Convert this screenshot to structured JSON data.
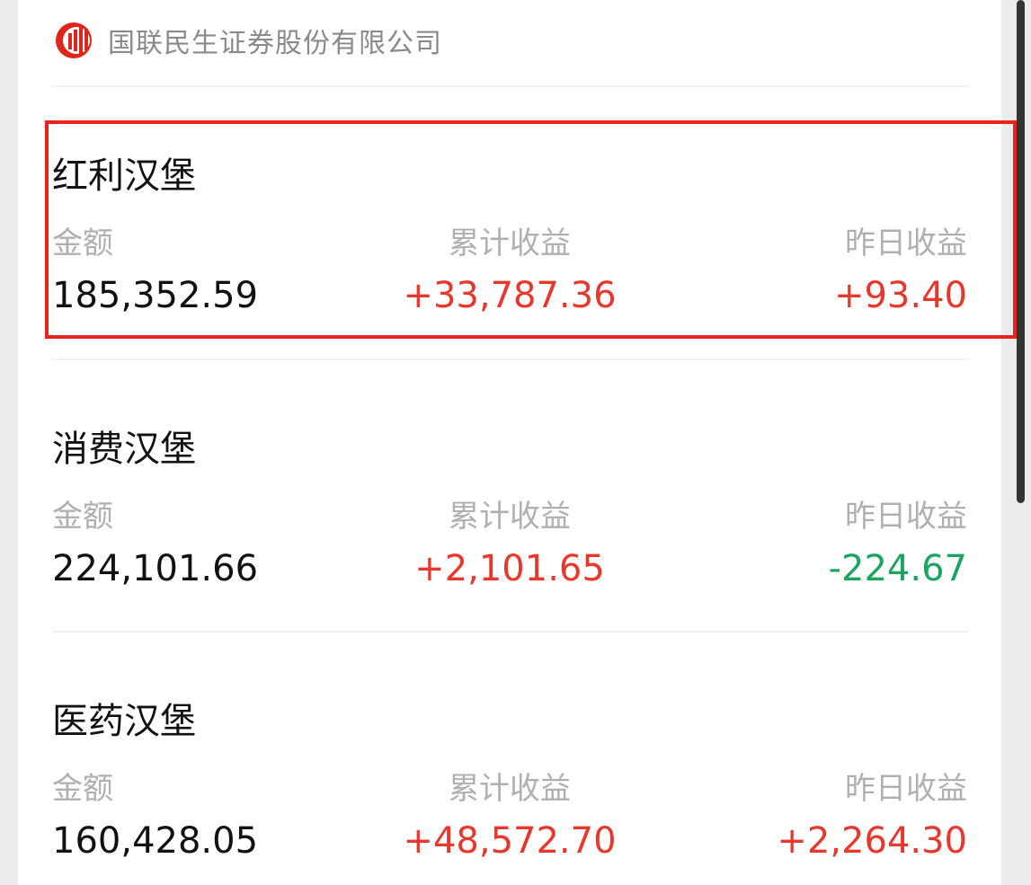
{
  "header": {
    "company": "国联民生证券股份有限公司",
    "logo_icon": "company-logo-icon"
  },
  "labels": {
    "amount": "金额",
    "cumulative": "累计收益",
    "yesterday": "昨日收益"
  },
  "funds": [
    {
      "name": "红利汉堡",
      "amount": "185,352.59",
      "cumulative": "+33,787.36",
      "yesterday": "+93.40",
      "highlighted": true
    },
    {
      "name": "消费汉堡",
      "amount": "224,101.66",
      "cumulative": "+2,101.65",
      "yesterday": "-224.67",
      "highlighted": false
    },
    {
      "name": "医药汉堡",
      "amount": "160,428.05",
      "cumulative": "+48,572.70",
      "yesterday": "+2,264.30",
      "highlighted": false
    }
  ],
  "colors": {
    "gain": "#e8372c",
    "loss": "#1aa560",
    "highlight_border": "#e8241c"
  }
}
